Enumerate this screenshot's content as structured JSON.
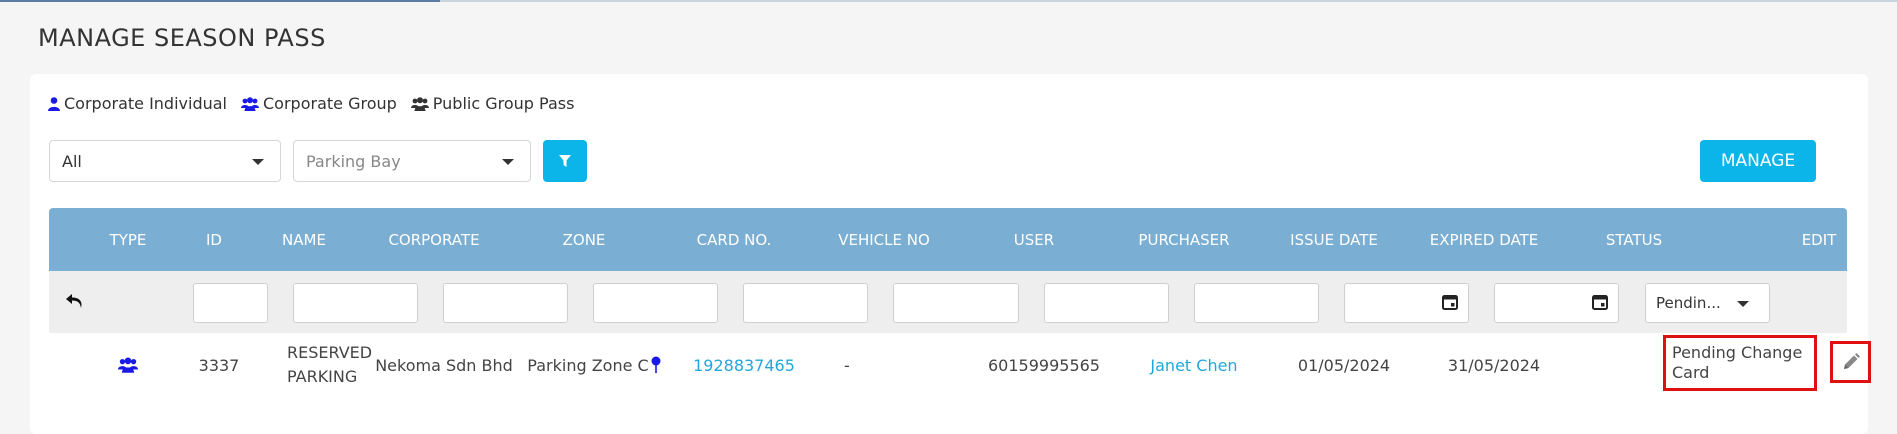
{
  "page": {
    "title": "MANAGE SEASON PASS"
  },
  "legend": [
    {
      "label": "Corporate Individual",
      "icon": "user-icon",
      "color": "#1a1ae6"
    },
    {
      "label": "Corporate Group",
      "icon": "users-icon",
      "color": "#1a1ae6"
    },
    {
      "label": "Public Group Pass",
      "icon": "users-icon",
      "color": "#333333"
    }
  ],
  "filters": {
    "type_value": "All",
    "parking_bay_placeholder": "Parking Bay",
    "filter_icon": "filter-icon",
    "manage_label": "MANAGE"
  },
  "colors": {
    "accent": "#0bb5ea",
    "header": "#7aaed3",
    "link": "#22a7dc",
    "highlight": "#e01010"
  },
  "table": {
    "columns": [
      "TYPE",
      "ID",
      "NAME",
      "CORPORATE",
      "ZONE",
      "CARD NO.",
      "VEHICLE NO",
      "USER",
      "PURCHASER",
      "ISSUE DATE",
      "EXPIRED DATE",
      "STATUS",
      "EDIT"
    ],
    "status_filter_value": "Pendin...",
    "rows": [
      {
        "type_icon": "users-icon",
        "id": "3337",
        "name_line1": "RESERVED",
        "name_line2": "PARKING",
        "corporate": "Nekoma Sdn Bhd",
        "zone": "Parking Zone C",
        "card_no": "1928837465",
        "vehicle_no": "-",
        "user": "60159995565",
        "purchaser": "Janet Chen",
        "issue_date": "01/05/2024",
        "expired_date": "31/05/2024",
        "status_line1": "Pending Change",
        "status_line2": "Card"
      }
    ]
  }
}
